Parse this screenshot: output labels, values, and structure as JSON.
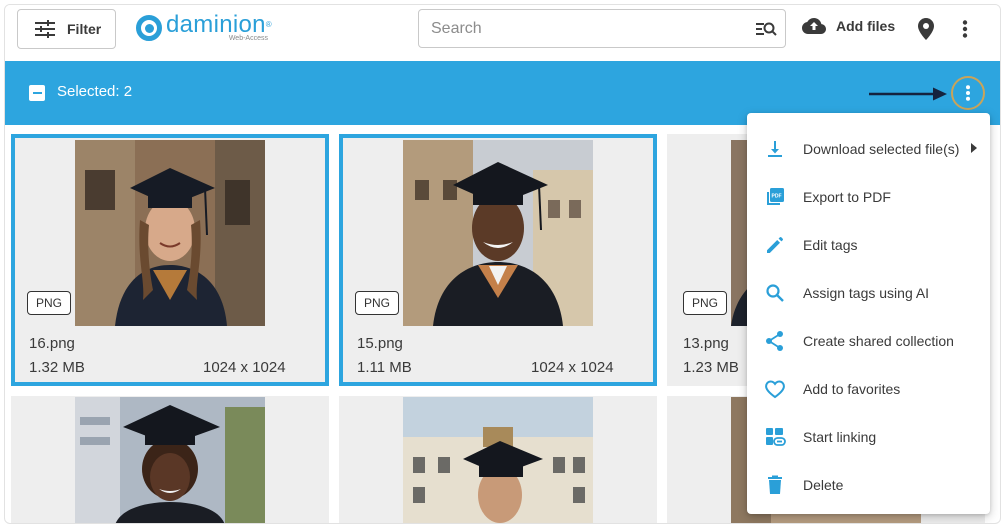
{
  "header": {
    "filter_label": "Filter",
    "logo_name": "daminion",
    "logo_mark": "®",
    "logo_sub": "Web-Access",
    "search_placeholder": "Search",
    "add_files_label": "Add files"
  },
  "selection": {
    "label": "Selected: 2"
  },
  "files": [
    {
      "badge": "PNG",
      "name": "16.png",
      "size": "1.32 MB",
      "dims": "1024 x 1024",
      "selected": true
    },
    {
      "badge": "PNG",
      "name": "15.png",
      "size": "1.11 MB",
      "dims": "1024 x 1024",
      "selected": true
    },
    {
      "badge": "PNG",
      "name": "13.png",
      "size": "1.23 MB",
      "dims": "",
      "selected": false
    }
  ],
  "menu": {
    "items": [
      {
        "label": "Download selected file(s)",
        "icon": "download-icon",
        "submenu": true
      },
      {
        "label": "Export to PDF",
        "icon": "pdf-icon"
      },
      {
        "label": "Edit tags",
        "icon": "pencil-icon"
      },
      {
        "label": "Assign tags using AI",
        "icon": "search-icon"
      },
      {
        "label": "Create shared collection",
        "icon": "share-icon"
      },
      {
        "label": "Add to favorites",
        "icon": "heart-icon"
      },
      {
        "label": "Start linking",
        "icon": "link-icon"
      },
      {
        "label": "Delete",
        "icon": "trash-icon"
      }
    ]
  },
  "colors": {
    "accent": "#2da5df",
    "logo": "#2a9fd8",
    "menu_icon": "#2a9fd8",
    "highlight_ring": "#c9a45a"
  }
}
